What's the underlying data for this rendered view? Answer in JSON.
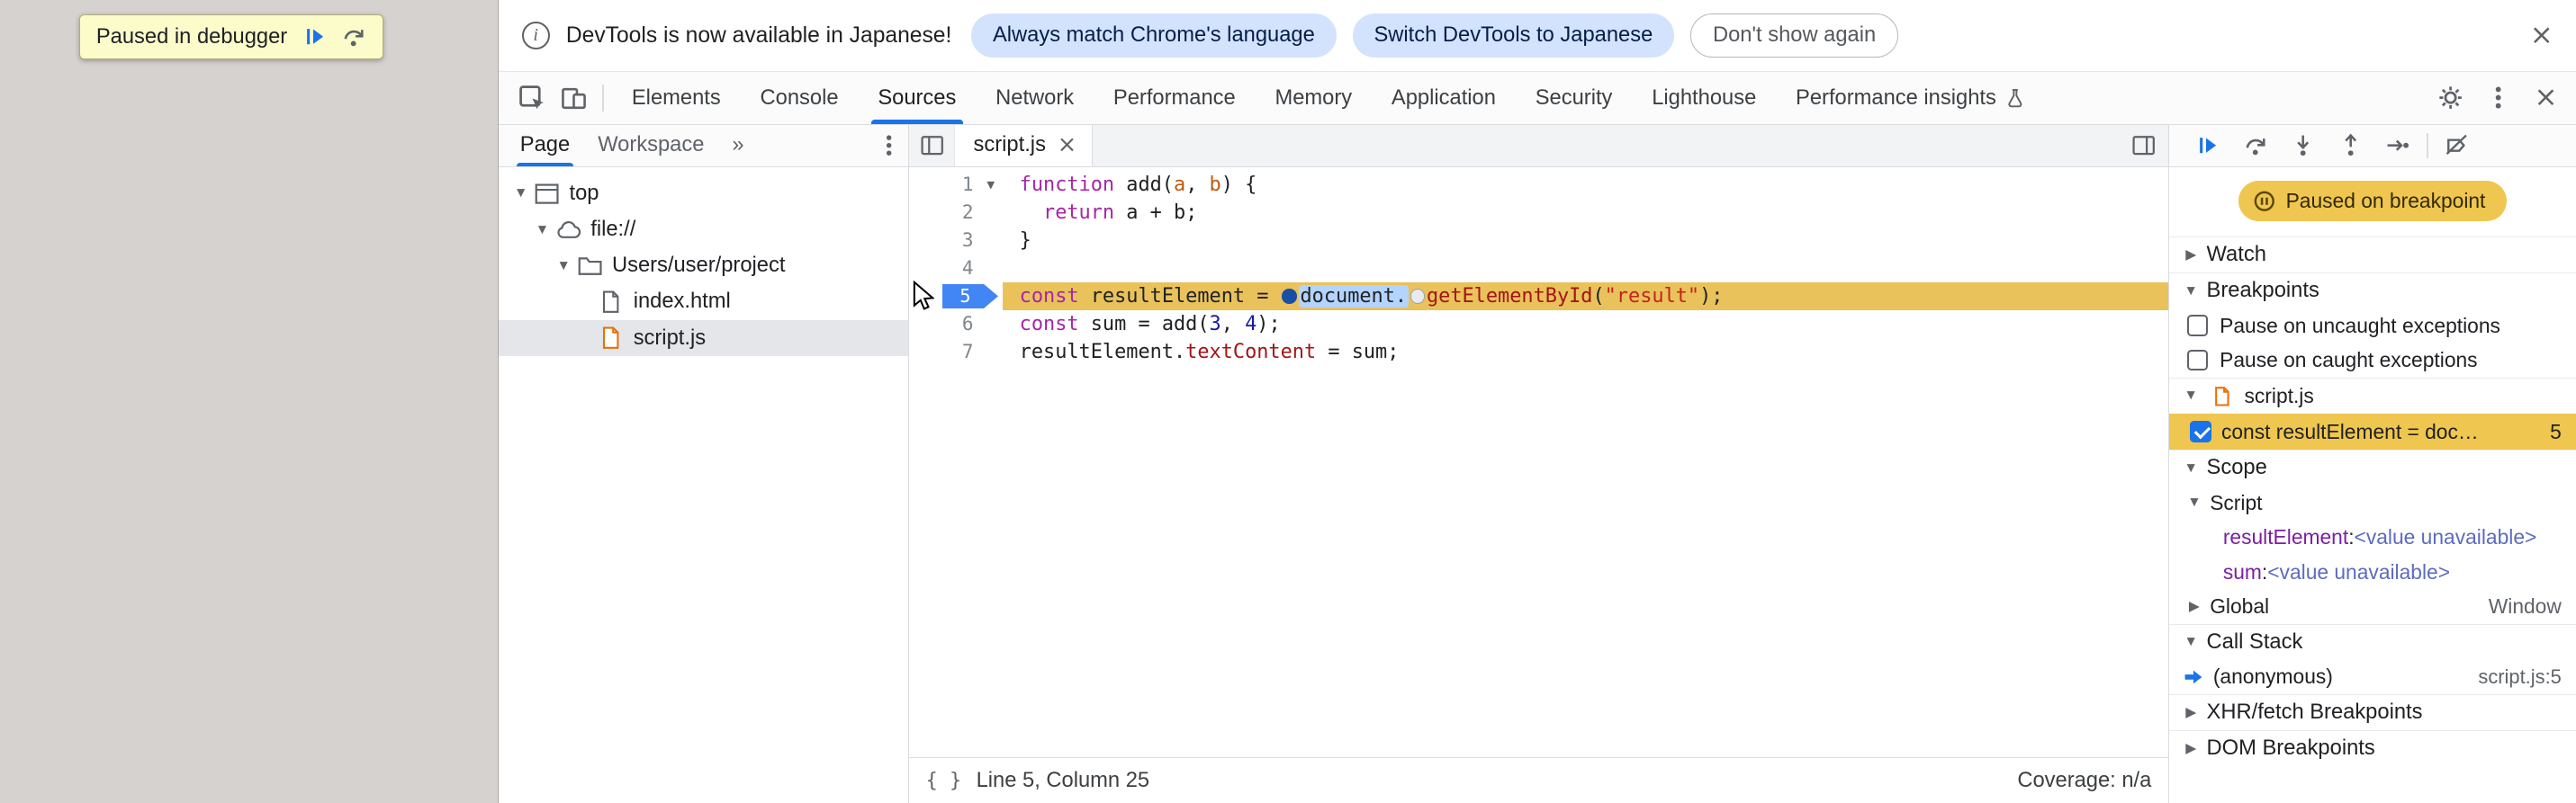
{
  "colors": {
    "accent_blue": "#1a73e8",
    "breakpoint_blue": "#4285f4",
    "paused_gold": "#efc64f",
    "execution_line_gold": "#e9c25b",
    "selection_blue": "#b3d4fc"
  },
  "icons": {
    "info_glyph": "i",
    "close": "×",
    "settings": "gear",
    "more": "kebab-dots",
    "inspect": "cursor-in-box",
    "device_toolbar": "phone-tablet",
    "flask": "beaker",
    "expand": "▼",
    "collapse": "▶",
    "more_tabs": "»",
    "braces": "{ }",
    "frame": "window-frame",
    "cloud": "cloud",
    "folder": "folder",
    "file": "document",
    "file_js": "document-js-orange",
    "resume": "play-with-bar",
    "step_over": "arc-arrow-over-dot",
    "step_into": "arrow-down-to-dot",
    "step_out": "arrow-up-from-dot",
    "step": "arrow-right-to-dot",
    "deactivate_breakpoints": "breakpoint-slashed",
    "paused": "pause-in-circle",
    "active_frame": "blue-arrow",
    "mouse": "cursor-arrow"
  },
  "page": {
    "paused_banner_label": "Paused in debugger"
  },
  "infobar": {
    "message": "DevTools is now available in Japanese!",
    "buttons": [
      {
        "label": "Always match Chrome's language"
      },
      {
        "label": "Switch DevTools to Japanese"
      },
      {
        "label": "Don't show again"
      }
    ]
  },
  "toolbar": {
    "tabs": [
      {
        "label": "Elements"
      },
      {
        "label": "Console"
      },
      {
        "label": "Sources",
        "selected": true
      },
      {
        "label": "Network"
      },
      {
        "label": "Performance"
      },
      {
        "label": "Memory"
      },
      {
        "label": "Application"
      },
      {
        "label": "Security"
      },
      {
        "label": "Lighthouse"
      },
      {
        "label": "Performance insights",
        "has_flask_icon": true
      }
    ]
  },
  "navigator": {
    "tabs": [
      {
        "label": "Page",
        "selected": true
      },
      {
        "label": "Workspace"
      }
    ],
    "tree": [
      {
        "label": "top",
        "icon": "frame",
        "expanded": true
      },
      {
        "label": "file://",
        "icon": "cloud",
        "expanded": true
      },
      {
        "label": "Users/user/project",
        "icon": "folder",
        "expanded": true
      },
      {
        "label": "index.html",
        "icon": "file"
      },
      {
        "label": "script.js",
        "icon": "file_js",
        "selected": true
      }
    ]
  },
  "editor": {
    "tab_label": "script.js",
    "status_left": "Line 5, Column 25",
    "status_right": "Coverage: n/a",
    "lines": [
      {
        "num": "1",
        "fold": true,
        "tokens": [
          {
            "t": "function",
            "c": "kw"
          },
          {
            "t": " add("
          },
          {
            "t": "a",
            "c": "def"
          },
          {
            "t": ", "
          },
          {
            "t": "b",
            "c": "def"
          },
          {
            "t": ") {"
          }
        ]
      },
      {
        "num": "2",
        "tokens": [
          {
            "t": "  "
          },
          {
            "t": "return",
            "c": "kw"
          },
          {
            "t": " a + b;"
          }
        ]
      },
      {
        "num": "3",
        "tokens": [
          {
            "t": "}"
          }
        ]
      },
      {
        "num": "4",
        "tokens": []
      },
      {
        "num": "5",
        "paused": true,
        "tokens": [
          {
            "t": "const",
            "c": "kw"
          },
          {
            "t": " resultElement = "
          },
          {
            "m": "dark"
          },
          {
            "t": "document.",
            "c": "sel"
          },
          {
            "m": "light"
          },
          {
            "t": "getElementById",
            "c": "prop"
          },
          {
            "t": "("
          },
          {
            "t": "\"result\"",
            "c": "str"
          },
          {
            "t": ");"
          }
        ]
      },
      {
        "num": "6",
        "tokens": [
          {
            "t": "const",
            "c": "kw"
          },
          {
            "t": " sum = add("
          },
          {
            "t": "3",
            "c": "num"
          },
          {
            "t": ", "
          },
          {
            "t": "4",
            "c": "num"
          },
          {
            "t": ");"
          }
        ]
      },
      {
        "num": "7",
        "tokens": [
          {
            "t": "resultElement."
          },
          {
            "t": "textContent",
            "c": "prop"
          },
          {
            "t": " = sum;"
          }
        ]
      }
    ]
  },
  "debugger": {
    "paused_message": "Paused on breakpoint",
    "watch": {
      "label": "Watch"
    },
    "breakpoints": {
      "label": "Breakpoints",
      "options": [
        {
          "label": "Pause on uncaught exceptions",
          "checked": false
        },
        {
          "label": "Pause on caught exceptions",
          "checked": false
        }
      ],
      "group_file": "script.js",
      "entry": {
        "text": "const resultElement = doc…",
        "line": "5",
        "checked": true
      }
    },
    "scope": {
      "label": "Scope",
      "script_group": "Script",
      "variables": [
        {
          "name": "resultElement",
          "value": "<value unavailable>"
        },
        {
          "name": "sum",
          "value": "<value unavailable>"
        }
      ],
      "global_group": "Global",
      "global_value": "Window"
    },
    "call_stack": {
      "label": "Call Stack",
      "frames": [
        {
          "name": "(anonymous)",
          "location": "script.js:5"
        }
      ]
    },
    "xhr": {
      "label": "XHR/fetch Breakpoints"
    },
    "dom": {
      "label": "DOM Breakpoints"
    }
  }
}
